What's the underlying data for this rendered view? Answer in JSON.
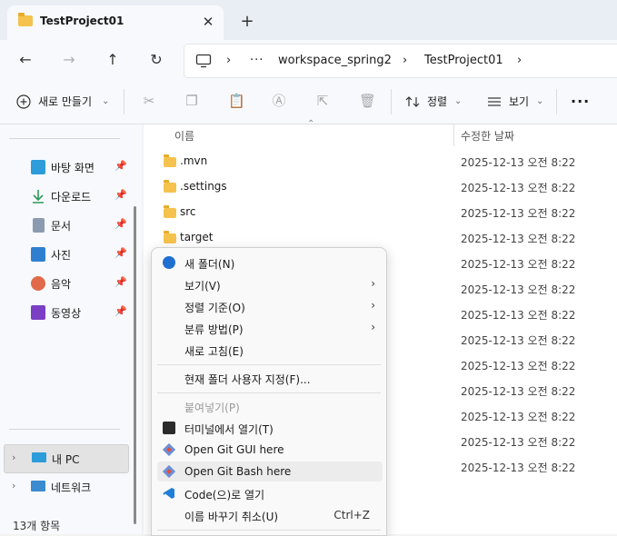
{
  "colors": {
    "accent": "#0067c0",
    "folder": "#f5c24d",
    "menu_bg": "#f9f9f9",
    "hover": "#ececec"
  },
  "tab": {
    "title": "TestProject01",
    "close": "✕",
    "new_tab": "+"
  },
  "nav": {
    "back": "←",
    "forward": "→",
    "up": "↑",
    "refresh": "↻"
  },
  "address": {
    "pc_icon": "monitor-icon",
    "sep": "›",
    "overflow": "···",
    "crumbs": [
      "workspace_spring2",
      "TestProject01"
    ]
  },
  "toolbar": {
    "new_label": "새로 만들기",
    "sort_label": "정렬",
    "view_label": "보기",
    "more": "···",
    "caret": "⌄"
  },
  "sidebar": {
    "items": [
      {
        "label": "바탕 화면",
        "icon": "desktop-icon",
        "color": "#2d9cdb"
      },
      {
        "label": "다운로드",
        "icon": "download-icon",
        "color": "#2e9a5a"
      },
      {
        "label": "문서",
        "icon": "document-icon",
        "color": "#8a9bb0"
      },
      {
        "label": "사진",
        "icon": "pictures-icon",
        "color": "#2f7fd1"
      },
      {
        "label": "음악",
        "icon": "music-icon",
        "color": "#e16a4b"
      },
      {
        "label": "동영상",
        "icon": "video-icon",
        "color": "#7a3fc4"
      }
    ],
    "pin": "📌",
    "mypc": "내 PC",
    "network": "네트워크",
    "status": "13개 항목"
  },
  "list": {
    "col_name": "이름",
    "col_date": "수정한 날짜",
    "sort_caret": "⌃",
    "rows": [
      {
        "name": ".mvn",
        "date": "2025-12-13 오전 8:22"
      },
      {
        "name": ".settings",
        "date": "2025-12-13 오전 8:22"
      },
      {
        "name": "src",
        "date": "2025-12-13 오전 8:22"
      },
      {
        "name": "target",
        "date": "2025-12-13 오전 8:22"
      },
      {
        "name": "",
        "date": "2025-12-13 오전 8:22"
      },
      {
        "name": "",
        "date": "2025-12-13 오전 8:22"
      },
      {
        "name": "",
        "date": "2025-12-13 오전 8:22"
      },
      {
        "name": "",
        "date": "2025-12-13 오전 8:22"
      },
      {
        "name": "",
        "date": "2025-12-13 오전 8:22"
      },
      {
        "name": "",
        "date": "2025-12-13 오전 8:22"
      },
      {
        "name": "",
        "date": "2025-12-13 오전 8:22"
      },
      {
        "name": "",
        "date": "2025-12-13 오전 8:22"
      },
      {
        "name": "",
        "date": "2025-12-13 오전 8:22"
      }
    ]
  },
  "context_menu": {
    "new_folder": "새 폴더(N)",
    "view": "보기(V)",
    "sort_by": "정렬 기준(O)",
    "group_by": "분류 방법(P)",
    "refresh": "새로 고침(E)",
    "customize": "현재 폴더 사용자 지정(F)...",
    "paste": "붙여넣기(P)",
    "terminal": "터미널에서 열기(T)",
    "git_gui": "Open Git GUI here",
    "git_bash": "Open Git Bash here",
    "vscode": "Code(으)로 열기",
    "undo_rename": "이름 바꾸기 취소(U)",
    "undo_shortcut": "Ctrl+Z",
    "submenu_arrow": "›"
  }
}
